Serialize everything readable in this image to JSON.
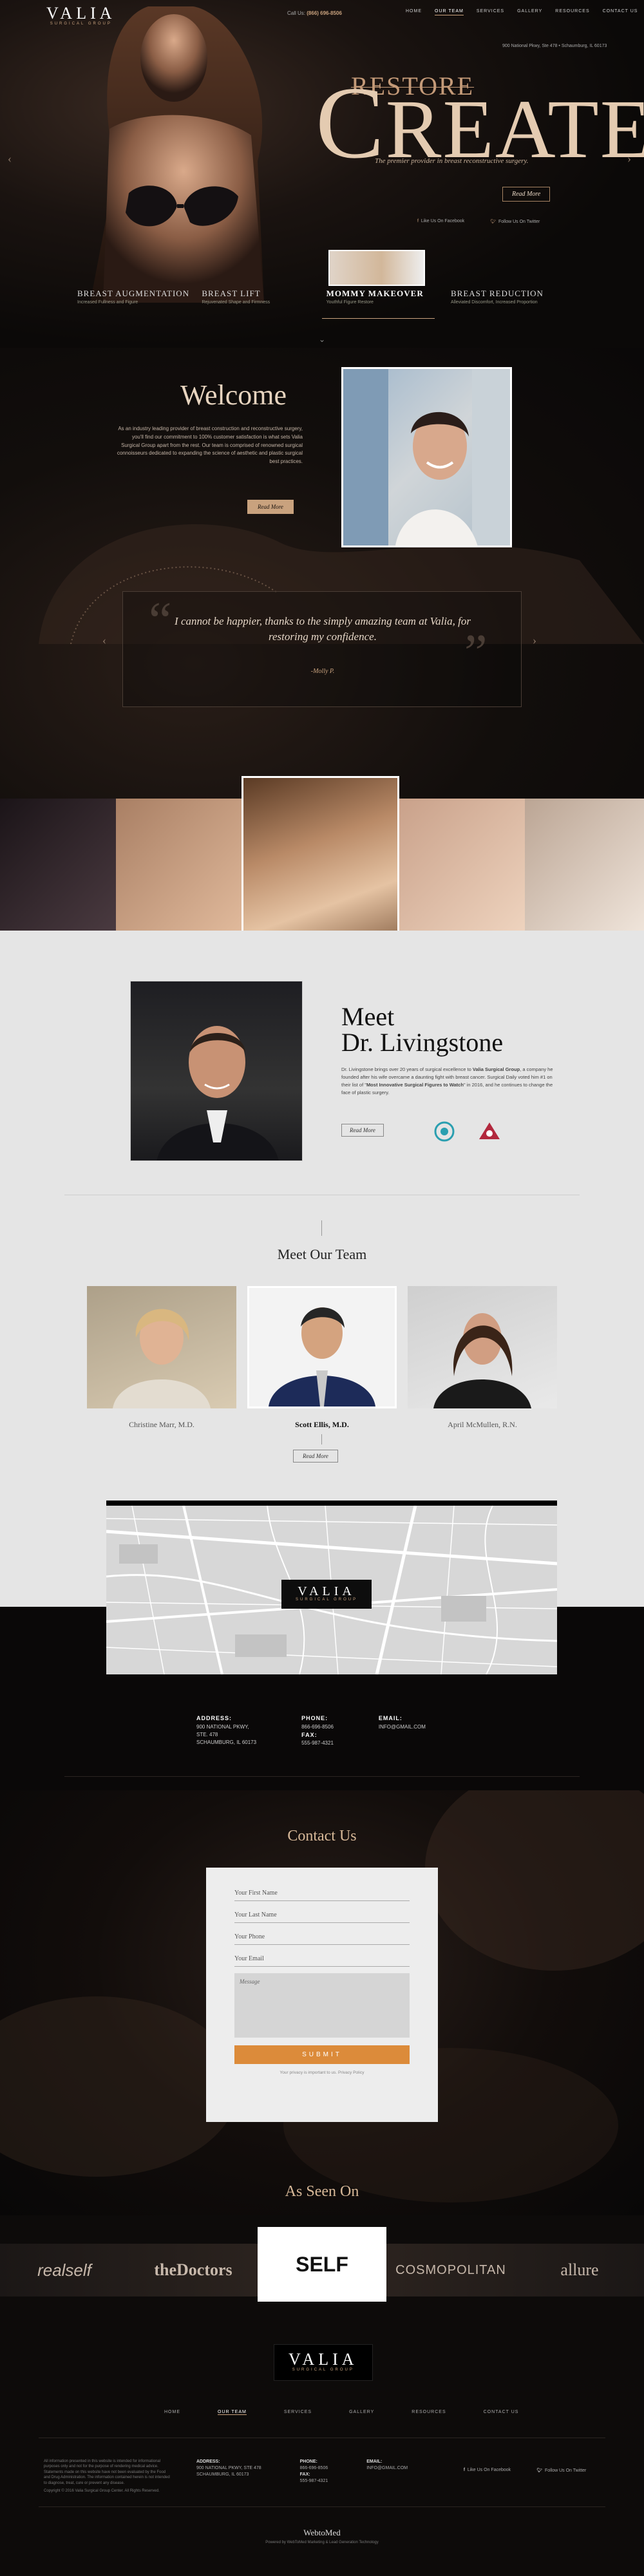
{
  "brand": {
    "name": "VALIA",
    "sub": "SURGICAL GROUP"
  },
  "header": {
    "phone_label": "Call Us:",
    "phone": "(866) 696-8506",
    "nav": [
      "HOME",
      "OUR TEAM",
      "SERVICES",
      "GALLERY",
      "RESOURCES",
      "CONTACT US"
    ],
    "nav_active_index": 1,
    "address": "900 National Pkwy, Ste 478 • Schaumburg, IL 60173"
  },
  "hero": {
    "restore": "RESTORE",
    "create": "CREATE",
    "tagline": "The premier provider in breast reconstructive surgery.",
    "read_more": "Read More",
    "facebook": "Like Us On Facebook",
    "twitter": "Follow Us On Twitter",
    "services": [
      {
        "title": "BREAST AUGMENTATION",
        "sub": "Increased Fullness and Figure"
      },
      {
        "title": "BREAST LIFT",
        "sub": "Rejuvenated Shape and Firmness"
      },
      {
        "title": "MOMMY MAKEOVER",
        "sub": "Youthful Figure Restore"
      },
      {
        "title": "BREAST REDUCTION",
        "sub": "Alleviated Discomfort, Increased Proportion"
      }
    ]
  },
  "welcome": {
    "heading": "Welcome",
    "body": "As an industry leading provider of breast construction and reconstructive surgery, you'll find our commitment to 100% customer satisfaction is what sets Valia Surgical Group apart from the rest. Our team is comprised of renowned surgical connoisseurs dedicated to expanding the science of aesthetic and plastic surgical best practices.",
    "button": "Read More"
  },
  "testimonial": {
    "quote": "I cannot be happier, thanks to the simply amazing team at Valia, for restoring my confidence.",
    "author": "-Molly P."
  },
  "doctor": {
    "heading_line1": "Meet",
    "heading_line2": "Dr. Livingstone",
    "bio_pre": "Dr. Livingstone brings over 20 years of surgical excellence to ",
    "bio_brand": "Valia Surgical Group",
    "bio_mid": ", a company he founded after his wife overcame a daunting fight with breast cancer. Surgical Daily voted him #1 on their list of \"",
    "bio_award": "Most Innovative Surgical Figures to Watch",
    "bio_post": "\" in 2016, and he continues to change the face of plastic surgery.",
    "button": "Read More"
  },
  "team": {
    "heading": "Meet Our Team",
    "members": [
      "Christine Marr, M.D.",
      "Scott Ellis, M.D.",
      "April McMullen, R.N."
    ],
    "active_index": 1,
    "button": "Read More"
  },
  "contact_info": {
    "address_label": "ADDRESS:",
    "address_lines": [
      "900 NATIONAL PKWY,",
      "STE. 478",
      "SCHAUMBURG, IL 60173"
    ],
    "phone_label": "PHONE:",
    "phone": "866-696-8506",
    "fax_label": "FAX:",
    "fax": "555-987-4321",
    "email_label": "EMAIL:",
    "email": "INFO@GMAIL.COM"
  },
  "contact_form": {
    "heading": "Contact Us",
    "first_name": "Your First Name",
    "last_name": "Your Last Name",
    "phone": "Your Phone",
    "email": "Your Email",
    "message": "Message",
    "submit": "SUBMIT",
    "privacy": "Your privacy is important to us. Privacy Policy"
  },
  "press": {
    "heading": "As Seen On",
    "outlets": [
      "realself",
      "theDoctors",
      "SELF",
      "COSMOPOLITAN",
      "allure"
    ],
    "active_index": 2
  },
  "footer": {
    "nav": [
      "HOME",
      "OUR TEAM",
      "SERVICES",
      "GALLERY",
      "RESOURCES",
      "CONTACT US"
    ],
    "nav_active_index": 1,
    "disclaimer": "All information presented in this website is intended for informational purposes only and not for the purpose of rendering medical advice. Statements made on this website have not been evaluated by the Food and Drug Administration. The information contained herein is not intended to diagnose, treat, cure or prevent any disease.",
    "copyright": "Copyright © 2016 Valia Surgical Group Center. All Rights Reserved.",
    "address_label": "ADDRESS:",
    "address": [
      "900 NATIONAL PKWY, STE 478",
      "SCHAUMBURG, IL 60173"
    ],
    "phone_label": "PHONE:",
    "phone": "866-696-8506",
    "fax_label": "FAX:",
    "fax": "555-987-4321",
    "email_label": "EMAIL:",
    "email": "INFO@GMAIL.COM",
    "facebook": "Like Us On Facebook",
    "twitter": "Follow Us On Twitter",
    "credit": "WebtoMed",
    "credit_sub": "Powered by WebToMed Marketing & Lead Generation Technology"
  },
  "colors": {
    "accent": "#c9a27e",
    "submit": "#dc8b3a",
    "light_bg": "#e5e5e5"
  }
}
